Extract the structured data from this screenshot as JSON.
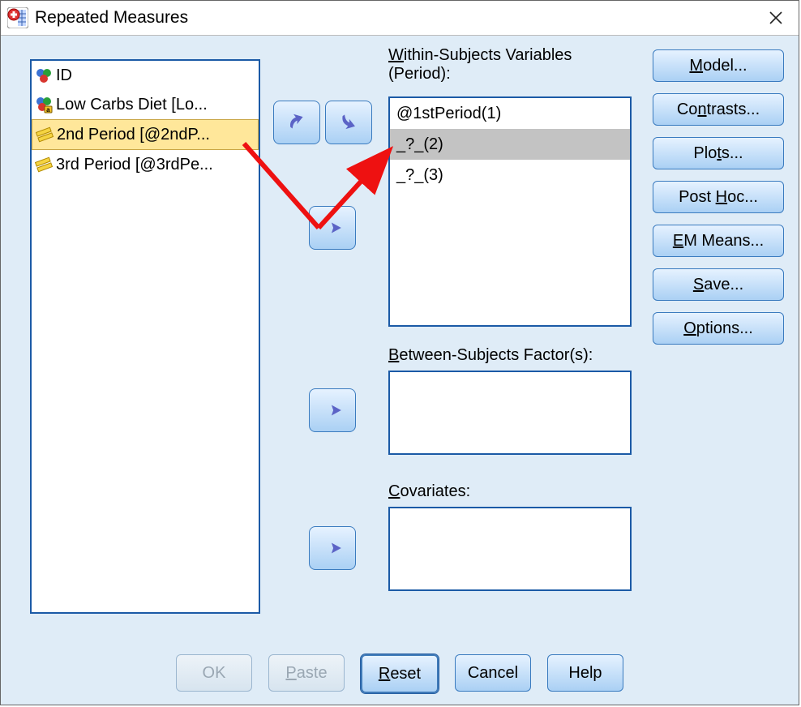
{
  "window": {
    "title": "Repeated Measures"
  },
  "source_vars": [
    {
      "label": "ID",
      "icon": "nominal"
    },
    {
      "label": "Low Carbs Diet [Lo...",
      "icon": "nominal-a"
    },
    {
      "label": "2nd Period [@2ndP...",
      "icon": "scale",
      "selected": true
    },
    {
      "label": "3rd Period [@3rdPe...",
      "icon": "scale"
    }
  ],
  "within": {
    "label_line1": "Within-Subjects Variables",
    "label_line2": "(Period):",
    "items": [
      {
        "text": "@1stPeriod(1)"
      },
      {
        "text": "_?_(2)",
        "selected": true
      },
      {
        "text": "_?_(3)"
      }
    ]
  },
  "between": {
    "label": "Between-Subjects Factor(s):"
  },
  "covariates": {
    "label": "Covariates:"
  },
  "sidebar": {
    "model": "Model...",
    "contrasts": "Contrasts...",
    "plots": "Plots...",
    "posthoc": "Post Hoc...",
    "emmeans": "EM Means...",
    "save": "Save...",
    "options": "Options..."
  },
  "bottom": {
    "ok": "OK",
    "paste": "Paste",
    "reset": "Reset",
    "cancel": "Cancel",
    "help": "Help"
  }
}
